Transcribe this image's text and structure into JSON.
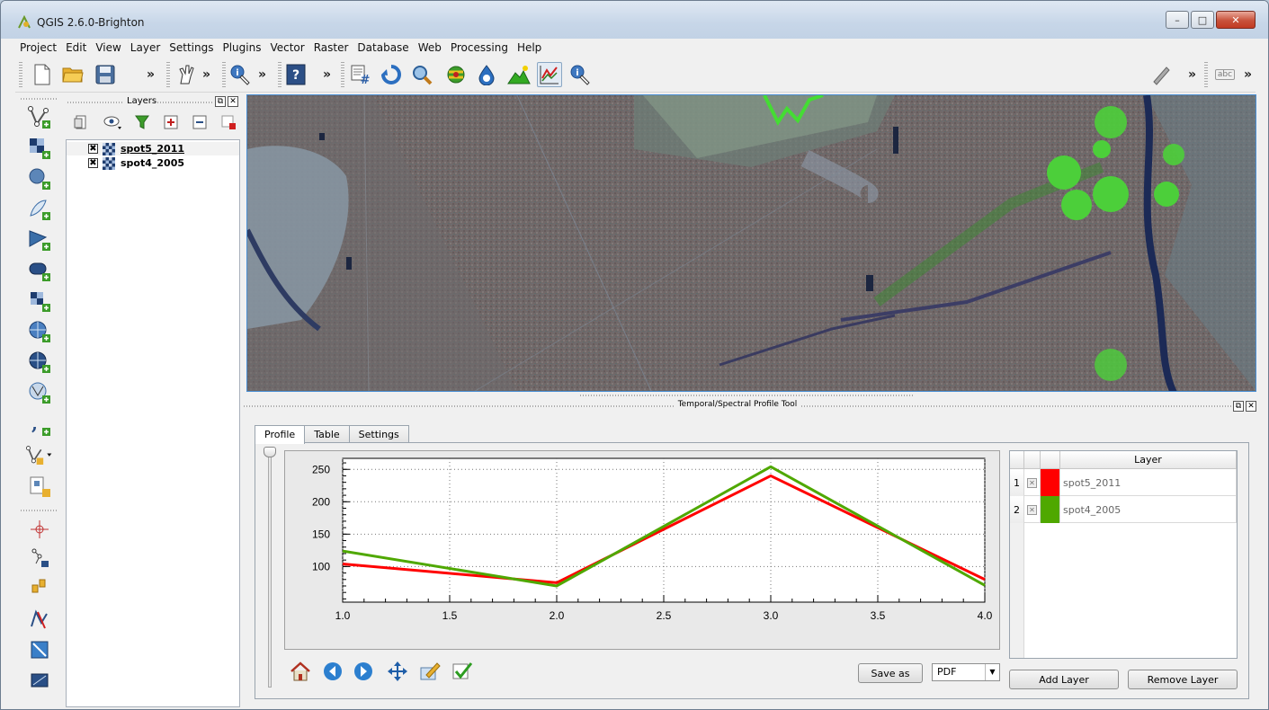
{
  "window": {
    "title": "QGIS 2.6.0-Brighton",
    "minimize": "–",
    "maximize": "□",
    "close": "✕"
  },
  "menu": [
    "Project",
    "Edit",
    "View",
    "Layer",
    "Settings",
    "Plugins",
    "Vector",
    "Raster",
    "Database",
    "Web",
    "Processing",
    "Help"
  ],
  "toolbar": {
    "overflow": "»",
    "icons": [
      "new-project-icon",
      "open-project-icon",
      "save-project-icon",
      "pan-map-icon",
      "identify-icon",
      "help-icon",
      "coordinate-capture-icon",
      "refresh-icon",
      "zoom-to-layer-icon",
      "processing-icon",
      "raster-info-icon",
      "terrain-icon",
      "profile-tool-icon",
      "identify-features-icon",
      "digitize-pencil-icon",
      "label-abc-icon"
    ],
    "label_tool": "abc"
  },
  "left_toolbar": {
    "icons": [
      "add-vector-layer-icon",
      "add-raster-layer-icon",
      "add-postgis-layer-icon",
      "add-spatialite-layer-icon",
      "add-mssql-layer-icon",
      "add-oracle-layer-icon",
      "add-sqlanywhere-layer-icon",
      "add-wms-layer-icon",
      "add-wcs-layer-icon",
      "add-wfs-layer-icon",
      "add-delimited-text-icon",
      "new-shapefile-icon",
      "add-virtual-layer-icon",
      "crosshair-tool-icon",
      "node-tool-icon",
      "offset-tool-icon",
      "split-tool-icon",
      "georeferencer-icon",
      "raster-terrain-icon"
    ]
  },
  "layers_panel": {
    "title": "Layers",
    "layers": [
      {
        "name": "spot5_2011",
        "checked": "✖",
        "selected": true
      },
      {
        "name": "spot4_2005",
        "checked": "✖",
        "selected": false
      }
    ]
  },
  "profile_tool": {
    "title": "Temporal/Spectral Profile Tool",
    "tabs": [
      "Profile",
      "Table",
      "Settings"
    ],
    "active_tab": "Profile",
    "save_as": "Save as",
    "format": "PDF",
    "add_layer": "Add Layer",
    "remove_layer": "Remove Layer",
    "table_header": "Layer",
    "rows": [
      {
        "num": "1",
        "check": "✕",
        "color": "#ff0000",
        "name": "spot5_2011"
      },
      {
        "num": "2",
        "check": "✕",
        "color": "#4fa800",
        "name": "spot4_2005"
      }
    ],
    "plot_tools": [
      "home-icon",
      "back-arrow-icon",
      "forward-arrow-icon",
      "pan-arrows-icon",
      "edit-settings-icon",
      "check-icon"
    ]
  },
  "chart_data": {
    "type": "line",
    "x": [
      1.0,
      2.0,
      3.0,
      4.0
    ],
    "series": [
      {
        "name": "spot5_2011",
        "color": "#ff0000",
        "values": [
          104,
          75,
          240,
          80
        ]
      },
      {
        "name": "spot4_2005",
        "color": "#4fa800",
        "values": [
          124,
          70,
          254,
          71
        ]
      }
    ],
    "xlim": [
      1.0,
      4.0
    ],
    "ylim": [
      45,
      267
    ],
    "xticks": [
      "1.0",
      "1.5",
      "2.0",
      "2.5",
      "3.0",
      "3.5",
      "4.0"
    ],
    "yticks": [
      "100",
      "150",
      "200",
      "250"
    ],
    "grid": true
  }
}
